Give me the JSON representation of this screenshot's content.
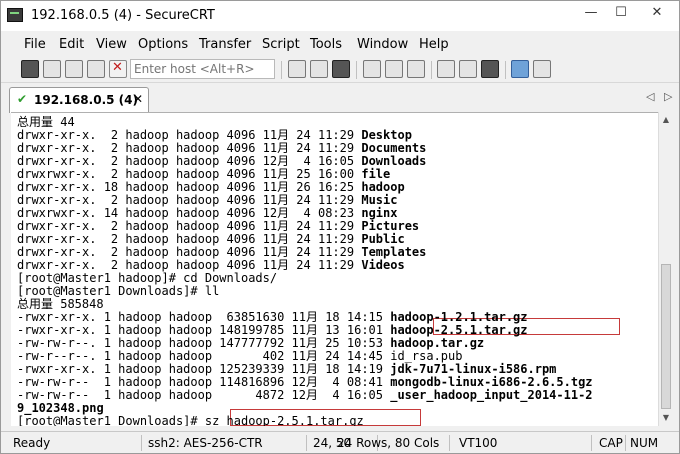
{
  "window": {
    "title": "192.168.0.5 (4) - SecureCRT",
    "minimize": "—",
    "maximize": "☐",
    "close": "✕"
  },
  "menubar": {
    "items": [
      "File",
      "Edit",
      "View",
      "Options",
      "Transfer",
      "Script",
      "Tools",
      "Window",
      "Help"
    ]
  },
  "toolbar": {
    "host_placeholder": "Enter host <Alt+R>",
    "icons": [
      "connect-icon",
      "quick-connect-icon",
      "connect-tab-icon",
      "reconnect-icon",
      "disconnect-icon",
      "copy-icon",
      "paste-icon",
      "find-icon",
      "print-icon",
      "print-setup-icon",
      "print-screen-icon",
      "session-options-icon",
      "global-options-icon",
      "keymap-icon",
      "help-icon",
      "info-icon"
    ]
  },
  "tabs": {
    "active_label": "192.168.0.5 (4)",
    "close": "✕",
    "nav_prev": "◁",
    "nav_next": "▷"
  },
  "terminal": {
    "lines": [
      {
        "pre": "总用量 44",
        "bold": ""
      },
      {
        "pre": "drwxr-xr-x.  2 hadoop hadoop 4096 11月 24 11:29 ",
        "bold": "Desktop"
      },
      {
        "pre": "drwxr-xr-x.  2 hadoop hadoop 4096 11月 24 11:29 ",
        "bold": "Documents"
      },
      {
        "pre": "drwxr-xr-x.  2 hadoop hadoop 4096 12月  4 16:05 ",
        "bold": "Downloads"
      },
      {
        "pre": "drwxrwxr-x.  2 hadoop hadoop 4096 11月 25 16:00 ",
        "bold": "file"
      },
      {
        "pre": "drwxr-xr-x. 18 hadoop hadoop 4096 11月 26 16:25 ",
        "bold": "hadoop"
      },
      {
        "pre": "drwxr-xr-x.  2 hadoop hadoop 4096 11月 24 11:29 ",
        "bold": "Music"
      },
      {
        "pre": "drwxrwxr-x. 14 hadoop hadoop 4096 12月  4 08:23 ",
        "bold": "nginx"
      },
      {
        "pre": "drwxr-xr-x.  2 hadoop hadoop 4096 11月 24 11:29 ",
        "bold": "Pictures"
      },
      {
        "pre": "drwxr-xr-x.  2 hadoop hadoop 4096 11月 24 11:29 ",
        "bold": "Public"
      },
      {
        "pre": "drwxr-xr-x.  2 hadoop hadoop 4096 11月 24 11:29 ",
        "bold": "Templates"
      },
      {
        "pre": "drwxr-xr-x.  2 hadoop hadoop 4096 11月 24 11:29 ",
        "bold": "Videos"
      },
      {
        "pre": "[root@Master1 hadoop]# cd Downloads/",
        "bold": ""
      },
      {
        "pre": "[root@Master1 Downloads]# ll",
        "bold": ""
      },
      {
        "pre": "总用量 585848",
        "bold": ""
      },
      {
        "pre": "-rwxr-xr-x. 1 hadoop hadoop  63851630 11月 18 14:15 ",
        "bold": "hadoop-1.2.1.tar.gz"
      },
      {
        "pre": "-rwxr-xr-x. 1 hadoop hadoop 148199785 11月 13 16:01 ",
        "bold": "hadoop-2.5.1.tar.gz"
      },
      {
        "pre": "-rw-rw-r--. 1 hadoop hadoop 147777792 11月 25 10:53 ",
        "bold": "hadoop.tar.gz"
      },
      {
        "pre": "-rw-r--r--. 1 hadoop hadoop       402 11月 24 14:45 id_rsa.pub",
        "bold": ""
      },
      {
        "pre": "-rwxr-xr-x. 1 hadoop hadoop 125239339 11月 18 14:19 ",
        "bold": "jdk-7u71-linux-i586.rpm"
      },
      {
        "pre": "-rw-rw-r--  1 hadoop hadoop 114816896 12月  4 08:41 ",
        "bold": "mongodb-linux-i686-2.6.5.tgz"
      },
      {
        "pre": "-rw-rw-r--  1 hadoop hadoop      4872 12月  4 16:05 ",
        "bold": "_user_hadoop_input_2014-11-2"
      },
      {
        "pre": "",
        "bold": "9_102348.png"
      },
      {
        "pre": "[root@Master1 Downloads]# sz hadoop-2.5.1.tar.gz",
        "bold": ""
      }
    ]
  },
  "statusbar": {
    "ready": "Ready",
    "protocol": "ssh2: AES-256-CTR",
    "cursor": "24,  50",
    "size": "24 Rows, 80 Cols",
    "terminal_type": "VT100",
    "caps": "CAP",
    "num": "NUM"
  }
}
